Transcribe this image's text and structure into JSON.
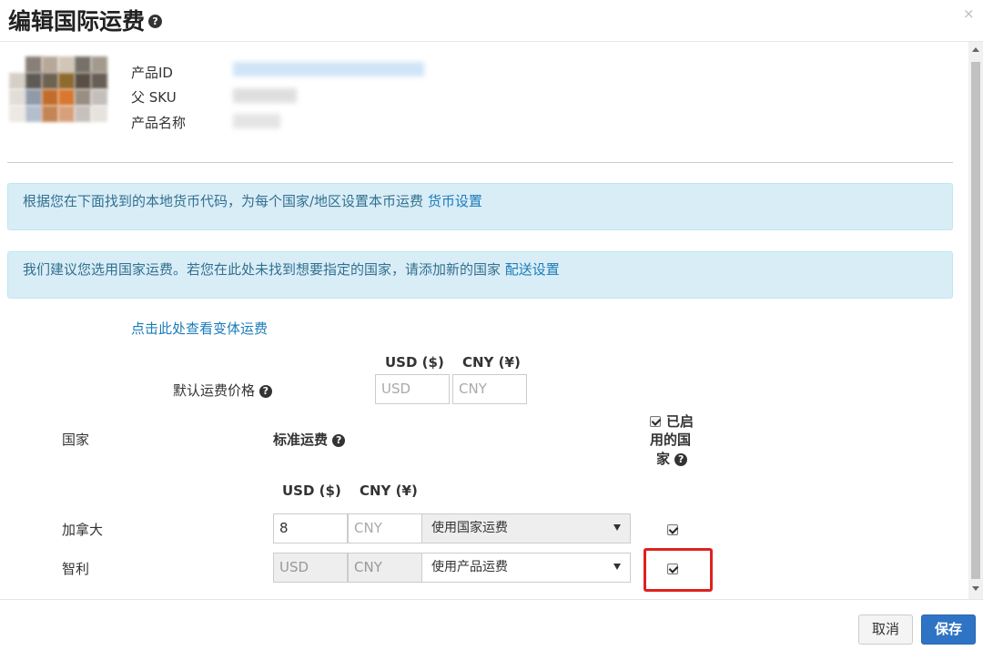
{
  "dialog": {
    "title": "编辑国际运费",
    "help_glyph": "?",
    "close_glyph": "×"
  },
  "product": {
    "id_label": "产品ID",
    "sku_label": "父 SKU",
    "name_label": "产品名称"
  },
  "alerts": {
    "currency_text": "根据您在下面找到的本地货币代码，为每个国家/地区设置本币运费",
    "currency_link": "货币设置",
    "country_text": "我们建议您选用国家运费。若您在此处未找到想要指定的国家，请添加新的国家",
    "country_link": "配送设置"
  },
  "variant_link": "点击此处查看变体运费",
  "default_price": {
    "label": "默认运费价格",
    "usd_header": "USD ($)",
    "cny_header": "CNY (¥)",
    "usd_placeholder": "USD",
    "cny_placeholder": "CNY"
  },
  "table": {
    "country_header": "国家",
    "standard_header": "标准运费",
    "enabled_header_line1": "已启",
    "enabled_header_line2": "用的国",
    "enabled_header_line3": "家",
    "usd_header": "USD ($)",
    "cny_header": "CNY (¥)",
    "rows": [
      {
        "country": "加拿大",
        "usd": "8",
        "cny": "CNY",
        "method": "使用国家运费",
        "enabled": true
      },
      {
        "country": "智利",
        "usd": "USD",
        "cny": "CNY",
        "method": "使用产品运费",
        "enabled": true
      }
    ]
  },
  "footer": {
    "cancel_label": "取消",
    "save_label": "保存"
  },
  "colors": {
    "alert_bg": "#d9edf7",
    "link": "#1a7bb9",
    "save_button": "#2f74c4",
    "highlight": "#e0201f"
  }
}
